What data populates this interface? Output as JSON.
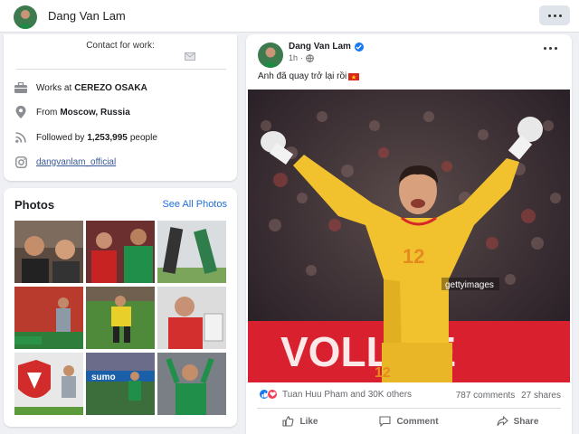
{
  "header": {
    "name": "Dang Van Lam",
    "more_icon": "more-horizontal-icon"
  },
  "intro": {
    "contact_label": "Contact for work:",
    "work": {
      "prefix": "Works at",
      "value": "CEREZO OSAKA",
      "icon": "briefcase-icon"
    },
    "from": {
      "prefix": "From",
      "value": "Moscow, Russia",
      "icon": "location-pin-icon"
    },
    "followers": {
      "prefix": "Followed by",
      "value": "1,253,995",
      "suffix": "people",
      "icon": "rss-icon"
    },
    "instagram": {
      "value": "dangvanlam_official",
      "icon": "instagram-icon"
    }
  },
  "photos": {
    "title": "Photos",
    "see_all": "See All Photos"
  },
  "post": {
    "author": "Dang Van Lam",
    "time": "1h",
    "text": "Anh đã quay trở lại rồi",
    "image_watermark": "gettyimages",
    "jersey_number": "12",
    "banner_text": "VOLLIFE",
    "reactions_text": "Tuan Huu Pham and 30K others",
    "comments": "787 comments",
    "shares": "27 shares",
    "like_label": "Like",
    "comment_label": "Comment",
    "share_label": "Share"
  },
  "colors": {
    "accent": "#216fdb",
    "jersey": "#f2c12e",
    "verified": "#1877f2"
  }
}
